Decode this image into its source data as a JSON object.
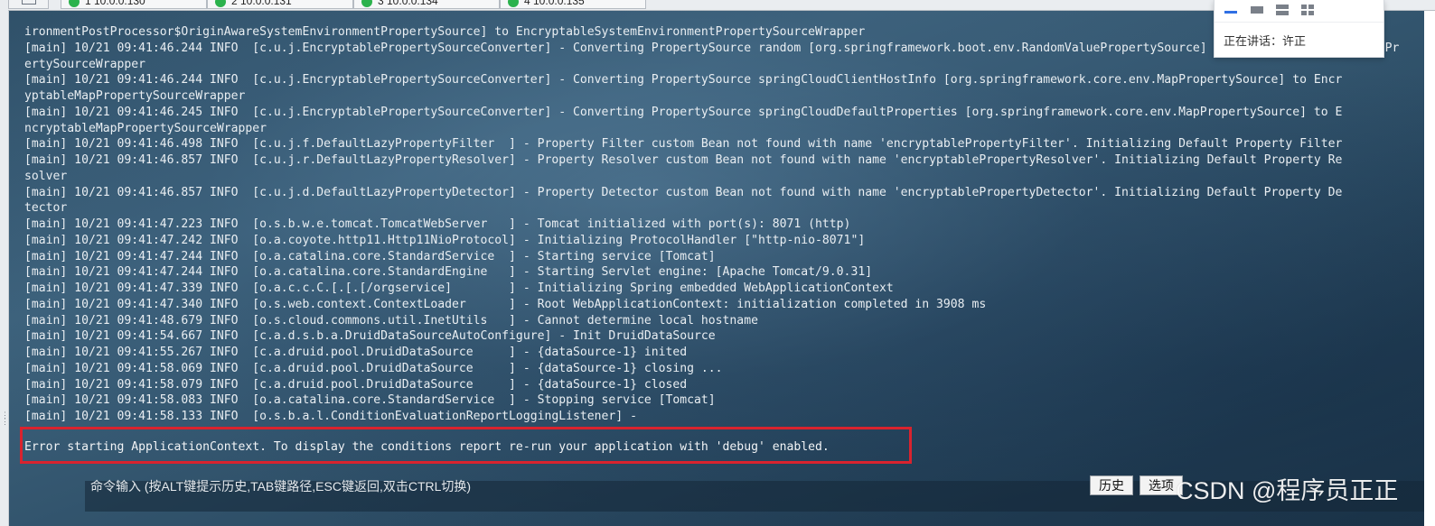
{
  "tabs": [
    {
      "label": "1 10.0.0.130",
      "status_color": "#2bb24c"
    },
    {
      "label": "2 10.0.0.131",
      "status_color": "#2bb24c"
    },
    {
      "label": "3 10.0.0.134",
      "status_color": "#2bb24c"
    },
    {
      "label": "4 10.0.0.135",
      "status_color": "#2bb24c"
    }
  ],
  "terminal": {
    "log_lines": [
      "ironmentPostProcessor$OriginAwareSystemEnvironmentPropertySource] to EncryptableSystemEnvironmentPropertySourceWrapper",
      "[main] 10/21 09:41:46.244 INFO  [c.u.j.EncryptablePropertySourceConverter] - Converting PropertySource random [org.springframework.boot.env.RandomValuePropertySource] to EncryptableEnumerablePr",
      "ertySourceWrapper",
      "[main] 10/21 09:41:46.244 INFO  [c.u.j.EncryptablePropertySourceConverter] - Converting PropertySource springCloudClientHostInfo [org.springframework.core.env.MapPropertySource] to Encr",
      "yptableMapPropertySourceWrapper",
      "[main] 10/21 09:41:46.245 INFO  [c.u.j.EncryptablePropertySourceConverter] - Converting PropertySource springCloudDefaultProperties [org.springframework.core.env.MapPropertySource] to E",
      "ncryptableMapPropertySourceWrapper",
      "[main] 10/21 09:41:46.498 INFO  [c.u.j.f.DefaultLazyPropertyFilter  ] - Property Filter custom Bean not found with name 'encryptablePropertyFilter'. Initializing Default Property Filter",
      "[main] 10/21 09:41:46.857 INFO  [c.u.j.r.DefaultLazyPropertyResolver] - Property Resolver custom Bean not found with name 'encryptablePropertyResolver'. Initializing Default Property Re",
      "solver",
      "[main] 10/21 09:41:46.857 INFO  [c.u.j.d.DefaultLazyPropertyDetector] - Property Detector custom Bean not found with name 'encryptablePropertyDetector'. Initializing Default Property De",
      "tector",
      "[main] 10/21 09:41:47.223 INFO  [o.s.b.w.e.tomcat.TomcatWebServer   ] - Tomcat initialized with port(s): 8071 (http)",
      "[main] 10/21 09:41:47.242 INFO  [o.a.coyote.http11.Http11NioProtocol] - Initializing ProtocolHandler [\"http-nio-8071\"]",
      "[main] 10/21 09:41:47.244 INFO  [o.a.catalina.core.StandardService  ] - Starting service [Tomcat]",
      "[main] 10/21 09:41:47.244 INFO  [o.a.catalina.core.StandardEngine   ] - Starting Servlet engine: [Apache Tomcat/9.0.31]",
      "[main] 10/21 09:41:47.339 INFO  [o.a.c.c.C.[.[.[/orgservice]        ] - Initializing Spring embedded WebApplicationContext",
      "[main] 10/21 09:41:47.340 INFO  [o.s.web.context.ContextLoader      ] - Root WebApplicationContext: initialization completed in 3908 ms",
      "[main] 10/21 09:41:48.679 INFO  [o.s.cloud.commons.util.InetUtils   ] - Cannot determine local hostname",
      "[main] 10/21 09:41:54.667 INFO  [c.a.d.s.b.a.DruidDataSourceAutoConfigure] - Init DruidDataSource",
      "[main] 10/21 09:41:55.267 INFO  [c.a.druid.pool.DruidDataSource     ] - {dataSource-1} inited",
      "[main] 10/21 09:41:58.069 INFO  [c.a.druid.pool.DruidDataSource     ] - {dataSource-1} closing ...",
      "[main] 10/21 09:41:58.079 INFO  [c.a.druid.pool.DruidDataSource     ] - {dataSource-1} closed",
      "[main] 10/21 09:41:58.083 INFO  [o.a.catalina.core.StandardService  ] - Stopping service [Tomcat]",
      "[main] 10/21 09:41:58.133 INFO  [o.s.b.a.l.ConditionEvaluationReportLoggingListener] -"
    ],
    "error_message": "Error starting ApplicationContext. To display the conditions report re-run your application with 'debug' enabled.",
    "highlight_color": "#d9232e"
  },
  "command_bar": {
    "label": "命令输入 (按ALT键提示历史,TAB键路径,ESC键返回,双击CTRL切换)",
    "history_button": "历史",
    "options_button": "选项"
  },
  "watermark": {
    "text": "CSDN @程序员正正"
  },
  "meeting_popup": {
    "speaking": "正在讲话：许正",
    "view_icons": [
      "speaker-view-icon",
      "gallery-view-icon",
      "list-view-icon",
      "grid-view-icon"
    ],
    "accent_color": "#2f6fe4"
  }
}
